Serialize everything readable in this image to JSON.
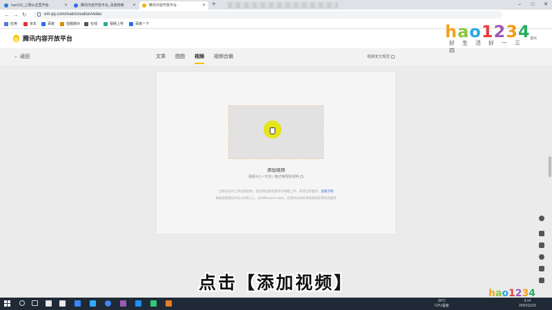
{
  "browser": {
    "tabs": [
      {
        "label": "hao123_上网从这里开始",
        "fav_color": "#2f7ad8",
        "active": false
      },
      {
        "label": "腾讯内容开放平台_百度搜索",
        "fav_color": "#2f6ee6",
        "active": false
      },
      {
        "label": "腾讯内容开放平台",
        "fav_color": "#f0b400",
        "active": true
      }
    ],
    "new_tab": "+",
    "window_controls": [
      "–",
      "□",
      "✕"
    ],
    "url": "om.qq.com/main/creation/video",
    "bookmarks": [
      {
        "label": "应用",
        "color": "#4a7bd0"
      },
      {
        "label": "京东",
        "color": "#d33"
      },
      {
        "label": "百度",
        "color": "#2f6ee6"
      },
      {
        "label": "拍题做对",
        "color": "#e08a00"
      },
      {
        "label": "在线",
        "color": "#555"
      },
      {
        "label": "视频上传",
        "color": "#3a9"
      },
      {
        "label": "百度一下",
        "color": "#2f6ee6"
      }
    ]
  },
  "site": {
    "logo_text": "腾讯内容开放平台",
    "exit": "退出",
    "back": "返回",
    "tabs": [
      {
        "label": "文章",
        "active": false
      },
      {
        "label": "图图",
        "active": false
      },
      {
        "label": "视频",
        "active": true
      },
      {
        "label": "视频合辑",
        "active": false
      }
    ],
    "spec_link": "视频发文规范"
  },
  "upload": {
    "title": "添加视频",
    "subtitle": "视频大小 / 时长 / 格式等规则说明",
    "note_line1": "企鹅号支持上传竖版视频，建议将竖版视频作为横版上传，获得全新推荐。",
    "note_link": "查看示例",
    "note_line2": "横版视频建议时长4分钟以上，分辨率≥1920*1080，合理时长和高清视频将获得优先推荐"
  },
  "caption": "点击【添加视频】",
  "watermark": {
    "brand": "hao123",
    "tagline": "好生活好一三四",
    "letters": [
      {
        "ch": "h",
        "color": "#f4a11a"
      },
      {
        "ch": "a",
        "color": "#8bc53f"
      },
      {
        "ch": "o",
        "color": "#29a9e1"
      },
      {
        "ch": "1",
        "color": "#e53e3e"
      },
      {
        "ch": "2",
        "color": "#9b59b6"
      },
      {
        "ch": "3",
        "color": "#f39c12"
      },
      {
        "ch": "4",
        "color": "#27ae60"
      }
    ]
  },
  "taskbar": {
    "weather": "39°C",
    "weather_label": "CPU温度",
    "time": "9:14",
    "date": "2020/11/19",
    "apps": [
      {
        "color": "#e8e8e8"
      },
      {
        "color": "#e8e8e8"
      },
      {
        "color": "#e8e8e8"
      },
      {
        "color": "#3a86ff"
      },
      {
        "color": "#ffb703"
      },
      {
        "color": "#31a8ff"
      },
      {
        "color": "#4285f4"
      },
      {
        "color": "#9b59b6"
      },
      {
        "color": "#31a8ff"
      },
      {
        "color": "#1e90ff"
      },
      {
        "color": "#2ecc71"
      },
      {
        "color": "#e67e22"
      }
    ]
  }
}
